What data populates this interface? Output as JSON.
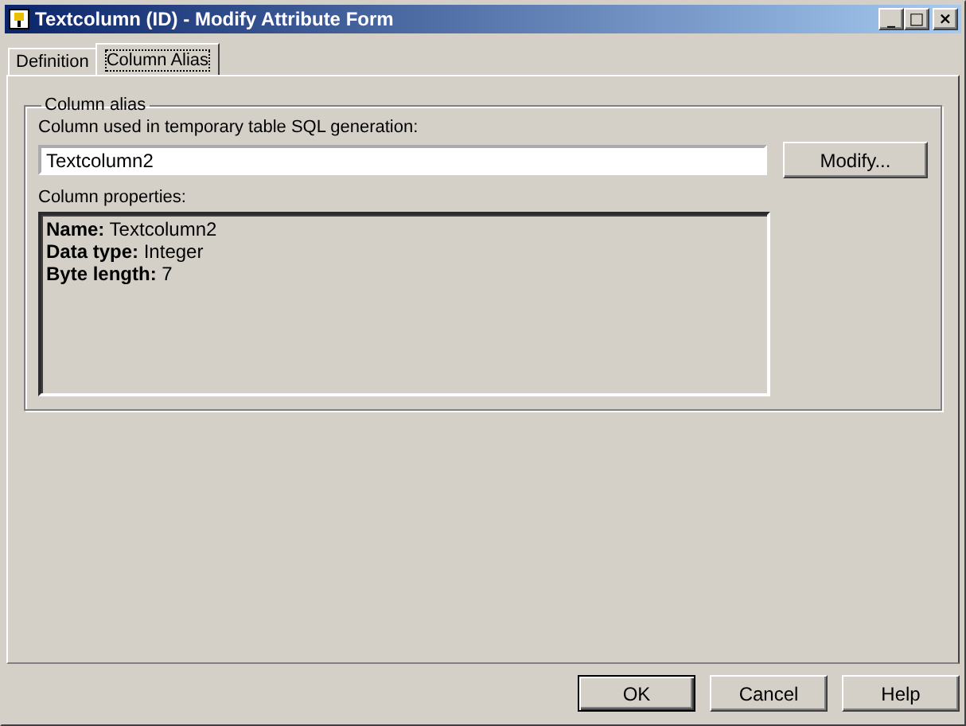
{
  "window": {
    "title": "Textcolumn (ID) - Modify Attribute Form",
    "controls": [
      "_",
      "□",
      "×"
    ]
  },
  "tabs": [
    {
      "label": "Definition",
      "selected": false
    },
    {
      "label": "Column Alias",
      "selected": true
    }
  ],
  "group": {
    "title": "Column alias",
    "field_label": "Column used in temporary table SQL generation:",
    "field_value": "Textcolumn2",
    "modify_button": "Modify...",
    "properties_label": "Column properties:",
    "properties": [
      "**Name:** Textcolumn2",
      "**Data type:** Integer",
      "**Byte length:** 7"
    ]
  },
  "buttons": [
    {
      "label": "OK",
      "default": true
    },
    {
      "label": "Cancel",
      "default": false
    },
    {
      "label": "Help",
      "default": false
    }
  ]
}
